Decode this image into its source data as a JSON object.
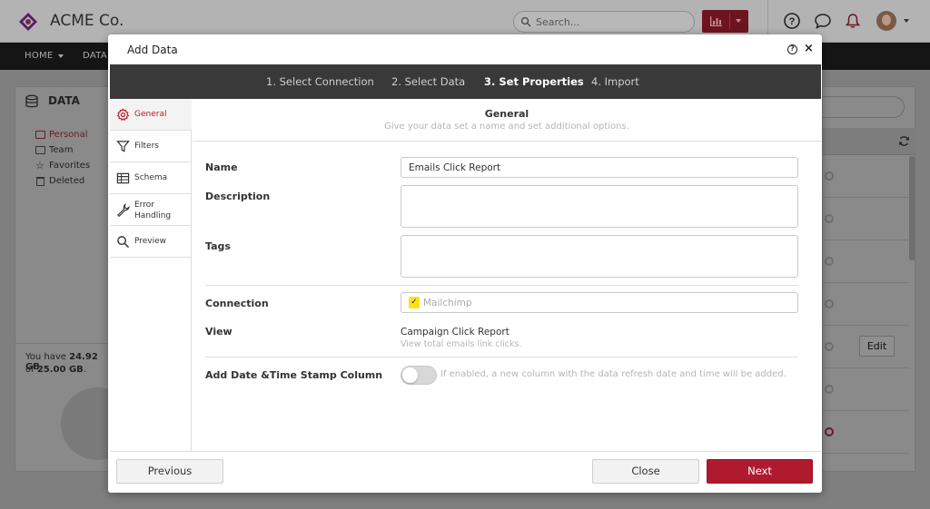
{
  "app": {
    "brand": "ACME Co.",
    "search_placeholder": "Search...",
    "accent_color": "#b01a2e",
    "nav": [
      "HOME",
      "DATA"
    ],
    "header_icons": [
      "help-icon",
      "chat-icon",
      "bell-icon"
    ]
  },
  "left_panel": {
    "title": "DATA",
    "folders": [
      "Personal",
      "Team",
      "Favorites",
      "Deleted"
    ],
    "usage_line1_prefix": "You have ",
    "usage_line1_value": "24.92 GB",
    "usage_line2_prefix": "of ",
    "usage_line2_value": "25.00 GB",
    "usage_line2_suffix": "."
  },
  "right_panel": {
    "edit_label": "Edit"
  },
  "modal": {
    "title": "Add Data",
    "steps": [
      "1. Select Connection",
      "2. Select Data",
      "3. Set Properties",
      "4. Import"
    ],
    "active_step": 2,
    "sidenav": [
      {
        "label": "General",
        "icon": "gear-icon"
      },
      {
        "label": "Filters",
        "icon": "filter-icon"
      },
      {
        "label": "Schema",
        "icon": "table-icon"
      },
      {
        "label": "Error Handling",
        "icon": "wrench-icon"
      },
      {
        "label": "Preview",
        "icon": "search-icon"
      }
    ],
    "section": {
      "title": "General",
      "subtitle": "Give your data set a name and set additional options."
    },
    "fields": {
      "name_label": "Name",
      "name_value": "Emails Click Report",
      "description_label": "Description",
      "description_value": "",
      "tags_label": "Tags",
      "tags_value": "",
      "connection_label": "Connection",
      "connection_value": "Mailchimp",
      "view_label": "View",
      "view_value": "Campaign Click Report",
      "view_sub": "View total emails link clicks.",
      "timestamp_label": "Add Date &Time Stamp Column",
      "timestamp_enabled": false,
      "timestamp_desc": "If enabled, a new column with the data refresh date and time will be added."
    },
    "footer": {
      "previous": "Previous",
      "close": "Close",
      "next": "Next"
    }
  }
}
